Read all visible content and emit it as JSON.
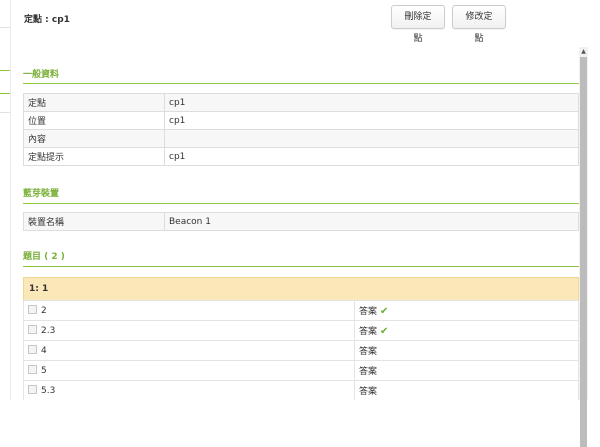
{
  "header": {
    "title": "定點 : cp1",
    "delete_label": "刪除定點",
    "edit_label": "修改定點"
  },
  "general": {
    "title": "一般資料",
    "rows": [
      {
        "key": "定點",
        "value": "cp1"
      },
      {
        "key": "位置",
        "value": "cp1"
      },
      {
        "key": "內容",
        "value": ""
      },
      {
        "key": "定點提示",
        "value": "cp1"
      }
    ]
  },
  "bluetooth": {
    "title": "藍芽裝置",
    "rows": [
      {
        "key": "裝置名稱",
        "value": "Beacon 1"
      }
    ]
  },
  "questions": {
    "title": "題目 ( 2 )",
    "header": "1: 1",
    "answer_label": "答案",
    "options": [
      {
        "label": "2",
        "correct": true
      },
      {
        "label": "2.3",
        "correct": true
      },
      {
        "label": "4",
        "correct": false
      },
      {
        "label": "5",
        "correct": false
      },
      {
        "label": "5.3",
        "correct": false
      }
    ]
  },
  "icons": {
    "check": "check-icon",
    "scroll_up": "scroll-up-arrow-icon"
  },
  "colors": {
    "accent": "#8dc63f",
    "section_title": "#7bb03a",
    "question_bg": "#fbe8b8"
  }
}
